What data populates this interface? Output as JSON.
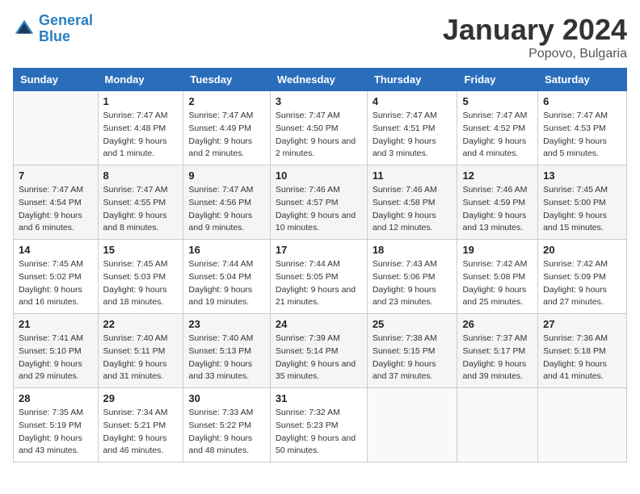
{
  "header": {
    "logo_line1": "General",
    "logo_line2": "Blue",
    "title": "January 2024",
    "subtitle": "Popovo, Bulgaria"
  },
  "days_of_week": [
    "Sunday",
    "Monday",
    "Tuesday",
    "Wednesday",
    "Thursday",
    "Friday",
    "Saturday"
  ],
  "weeks": [
    [
      {
        "day": "",
        "sunrise": "",
        "sunset": "",
        "daylight": ""
      },
      {
        "day": "1",
        "sunrise": "Sunrise: 7:47 AM",
        "sunset": "Sunset: 4:48 PM",
        "daylight": "Daylight: 9 hours and 1 minute."
      },
      {
        "day": "2",
        "sunrise": "Sunrise: 7:47 AM",
        "sunset": "Sunset: 4:49 PM",
        "daylight": "Daylight: 9 hours and 2 minutes."
      },
      {
        "day": "3",
        "sunrise": "Sunrise: 7:47 AM",
        "sunset": "Sunset: 4:50 PM",
        "daylight": "Daylight: 9 hours and 2 minutes."
      },
      {
        "day": "4",
        "sunrise": "Sunrise: 7:47 AM",
        "sunset": "Sunset: 4:51 PM",
        "daylight": "Daylight: 9 hours and 3 minutes."
      },
      {
        "day": "5",
        "sunrise": "Sunrise: 7:47 AM",
        "sunset": "Sunset: 4:52 PM",
        "daylight": "Daylight: 9 hours and 4 minutes."
      },
      {
        "day": "6",
        "sunrise": "Sunrise: 7:47 AM",
        "sunset": "Sunset: 4:53 PM",
        "daylight": "Daylight: 9 hours and 5 minutes."
      }
    ],
    [
      {
        "day": "7",
        "sunrise": "Sunrise: 7:47 AM",
        "sunset": "Sunset: 4:54 PM",
        "daylight": "Daylight: 9 hours and 6 minutes."
      },
      {
        "day": "8",
        "sunrise": "Sunrise: 7:47 AM",
        "sunset": "Sunset: 4:55 PM",
        "daylight": "Daylight: 9 hours and 8 minutes."
      },
      {
        "day": "9",
        "sunrise": "Sunrise: 7:47 AM",
        "sunset": "Sunset: 4:56 PM",
        "daylight": "Daylight: 9 hours and 9 minutes."
      },
      {
        "day": "10",
        "sunrise": "Sunrise: 7:46 AM",
        "sunset": "Sunset: 4:57 PM",
        "daylight": "Daylight: 9 hours and 10 minutes."
      },
      {
        "day": "11",
        "sunrise": "Sunrise: 7:46 AM",
        "sunset": "Sunset: 4:58 PM",
        "daylight": "Daylight: 9 hours and 12 minutes."
      },
      {
        "day": "12",
        "sunrise": "Sunrise: 7:46 AM",
        "sunset": "Sunset: 4:59 PM",
        "daylight": "Daylight: 9 hours and 13 minutes."
      },
      {
        "day": "13",
        "sunrise": "Sunrise: 7:45 AM",
        "sunset": "Sunset: 5:00 PM",
        "daylight": "Daylight: 9 hours and 15 minutes."
      }
    ],
    [
      {
        "day": "14",
        "sunrise": "Sunrise: 7:45 AM",
        "sunset": "Sunset: 5:02 PM",
        "daylight": "Daylight: 9 hours and 16 minutes."
      },
      {
        "day": "15",
        "sunrise": "Sunrise: 7:45 AM",
        "sunset": "Sunset: 5:03 PM",
        "daylight": "Daylight: 9 hours and 18 minutes."
      },
      {
        "day": "16",
        "sunrise": "Sunrise: 7:44 AM",
        "sunset": "Sunset: 5:04 PM",
        "daylight": "Daylight: 9 hours and 19 minutes."
      },
      {
        "day": "17",
        "sunrise": "Sunrise: 7:44 AM",
        "sunset": "Sunset: 5:05 PM",
        "daylight": "Daylight: 9 hours and 21 minutes."
      },
      {
        "day": "18",
        "sunrise": "Sunrise: 7:43 AM",
        "sunset": "Sunset: 5:06 PM",
        "daylight": "Daylight: 9 hours and 23 minutes."
      },
      {
        "day": "19",
        "sunrise": "Sunrise: 7:42 AM",
        "sunset": "Sunset: 5:08 PM",
        "daylight": "Daylight: 9 hours and 25 minutes."
      },
      {
        "day": "20",
        "sunrise": "Sunrise: 7:42 AM",
        "sunset": "Sunset: 5:09 PM",
        "daylight": "Daylight: 9 hours and 27 minutes."
      }
    ],
    [
      {
        "day": "21",
        "sunrise": "Sunrise: 7:41 AM",
        "sunset": "Sunset: 5:10 PM",
        "daylight": "Daylight: 9 hours and 29 minutes."
      },
      {
        "day": "22",
        "sunrise": "Sunrise: 7:40 AM",
        "sunset": "Sunset: 5:11 PM",
        "daylight": "Daylight: 9 hours and 31 minutes."
      },
      {
        "day": "23",
        "sunrise": "Sunrise: 7:40 AM",
        "sunset": "Sunset: 5:13 PM",
        "daylight": "Daylight: 9 hours and 33 minutes."
      },
      {
        "day": "24",
        "sunrise": "Sunrise: 7:39 AM",
        "sunset": "Sunset: 5:14 PM",
        "daylight": "Daylight: 9 hours and 35 minutes."
      },
      {
        "day": "25",
        "sunrise": "Sunrise: 7:38 AM",
        "sunset": "Sunset: 5:15 PM",
        "daylight": "Daylight: 9 hours and 37 minutes."
      },
      {
        "day": "26",
        "sunrise": "Sunrise: 7:37 AM",
        "sunset": "Sunset: 5:17 PM",
        "daylight": "Daylight: 9 hours and 39 minutes."
      },
      {
        "day": "27",
        "sunrise": "Sunrise: 7:36 AM",
        "sunset": "Sunset: 5:18 PM",
        "daylight": "Daylight: 9 hours and 41 minutes."
      }
    ],
    [
      {
        "day": "28",
        "sunrise": "Sunrise: 7:35 AM",
        "sunset": "Sunset: 5:19 PM",
        "daylight": "Daylight: 9 hours and 43 minutes."
      },
      {
        "day": "29",
        "sunrise": "Sunrise: 7:34 AM",
        "sunset": "Sunset: 5:21 PM",
        "daylight": "Daylight: 9 hours and 46 minutes."
      },
      {
        "day": "30",
        "sunrise": "Sunrise: 7:33 AM",
        "sunset": "Sunset: 5:22 PM",
        "daylight": "Daylight: 9 hours and 48 minutes."
      },
      {
        "day": "31",
        "sunrise": "Sunrise: 7:32 AM",
        "sunset": "Sunset: 5:23 PM",
        "daylight": "Daylight: 9 hours and 50 minutes."
      },
      {
        "day": "",
        "sunrise": "",
        "sunset": "",
        "daylight": ""
      },
      {
        "day": "",
        "sunrise": "",
        "sunset": "",
        "daylight": ""
      },
      {
        "day": "",
        "sunrise": "",
        "sunset": "",
        "daylight": ""
      }
    ]
  ]
}
